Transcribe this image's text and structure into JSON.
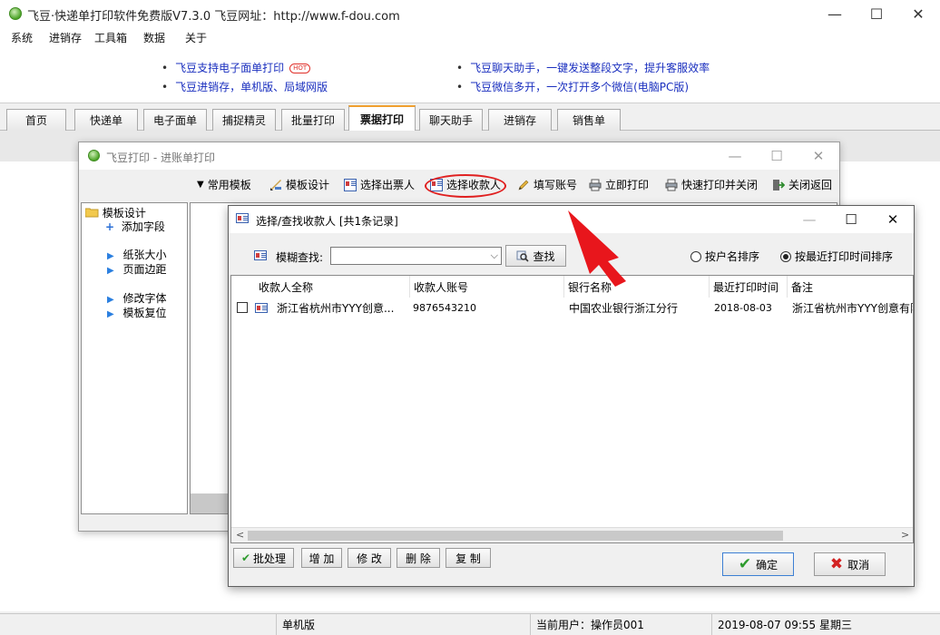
{
  "app": {
    "title": "飞豆·快递单打印软件免费版V7.3.0  飞豆网址：http://www.f-dou.com",
    "window_controls": {
      "minimize": "—",
      "maximize": "☐",
      "close": "✕"
    }
  },
  "menubar": [
    "系统",
    "进销存",
    "工具箱",
    "数据",
    "关于"
  ],
  "ads": {
    "left": [
      "飞豆支持电子面单打印",
      "飞豆进销存，单机版、局域网版"
    ],
    "hot": "HOT",
    "right": [
      "飞豆聊天助手，一键发送整段文字，提升客服效率",
      "飞豆微信多开，一次打开多个微信(电脑PC版)"
    ]
  },
  "tabs": [
    "首页",
    "快递单",
    "电子面单",
    "捕捉精灵",
    "批量打印",
    "票据打印",
    "聊天助手",
    "进销存",
    "销售单"
  ],
  "active_tab": "票据打印",
  "print_window": {
    "title": "飞豆打印 - 进账单打印",
    "toolbar": [
      "常用模板",
      "模板设计",
      "选择出票人",
      "选择收款人",
      "填写账号",
      "立即打印",
      "快速打印并关闭",
      "关闭返回"
    ],
    "tree": {
      "root": "模板设计",
      "add_field": "添加字段",
      "items": [
        "纸张大小",
        "页面边距",
        "修改字体",
        "模板复位"
      ]
    }
  },
  "dialog": {
    "title": "选择/查找收款人  [共1条记录]",
    "search_label": "模糊查找:",
    "search_value": "",
    "search_button": "查找",
    "sort_by_name": "按户名排序",
    "sort_by_time": "按最近打印时间排序",
    "sort_selected": "按最近打印时间排序",
    "columns": [
      "收款人全称",
      "收款人账号",
      "银行名称",
      "最近打印时间",
      "备注"
    ],
    "rows": [
      {
        "name": "浙江省杭州市YYY创意...",
        "account": "9876543210",
        "bank": "中国农业银行浙江分行",
        "last_print": "2018-08-03",
        "note": "浙江省杭州市YYY创意有限"
      }
    ],
    "buttons": {
      "batch": "批处理",
      "add": "增 加",
      "edit": "修 改",
      "delete": "删 除",
      "copy": "复 制",
      "ok": "确定",
      "cancel": "取消"
    }
  },
  "status": {
    "mode": "单机版",
    "user": "当前用户：操作员001",
    "datetime": "2019-08-07 09:55 星期三"
  },
  "colors": {
    "ad_link": "#1a2fbf",
    "highlight": "#e02020",
    "arrow": "#e8161c"
  }
}
